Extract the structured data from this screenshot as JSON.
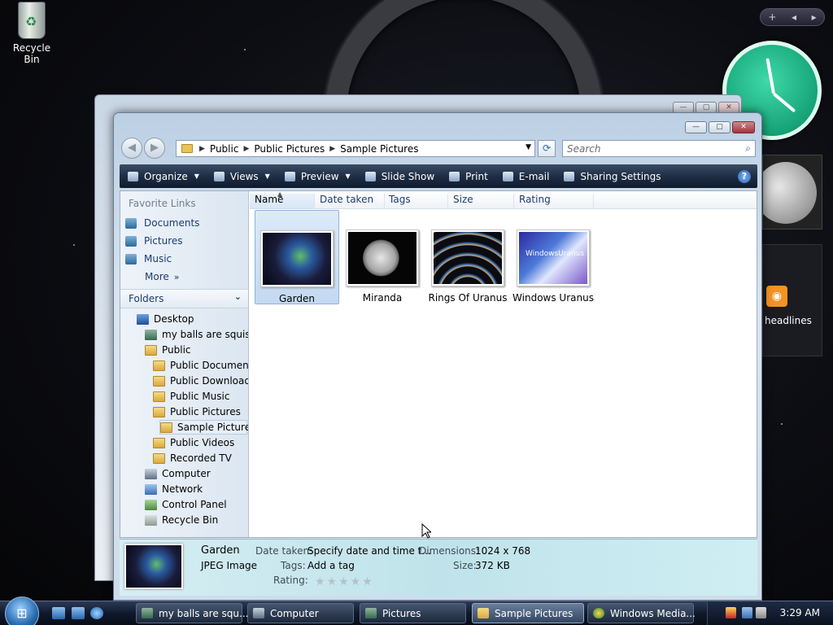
{
  "desktop": {
    "recycle_bin_label": "Recycle Bin"
  },
  "gadgets": {
    "feed_text": "headlines",
    "ctrl_add": "+",
    "ctrl_prev": "◂",
    "ctrl_next": "▸"
  },
  "window": {
    "controls": {
      "minimize": "—",
      "maximize": "▢",
      "close": "✕"
    },
    "address": {
      "crumbs": [
        "Public",
        "Public Pictures",
        "Sample Pictures"
      ]
    },
    "search_placeholder": "Search",
    "toolbar": {
      "organize": "Organize",
      "views": "Views",
      "preview": "Preview",
      "slideshow": "Slide Show",
      "print": "Print",
      "email": "E-mail",
      "sharing": "Sharing Settings"
    },
    "favorite_links": {
      "title": "Favorite Links",
      "items": [
        "Documents",
        "Pictures",
        "Music",
        "More"
      ]
    },
    "folders_title": "Folders",
    "tree": [
      "Desktop",
      "my balls are squishy",
      "Public",
      "Public Documents",
      "Public Downloads",
      "Public Music",
      "Public Pictures",
      "Sample Pictures",
      "Public Videos",
      "Recorded TV",
      "Computer",
      "Network",
      "Control Panel",
      "Recycle Bin"
    ],
    "columns": [
      "Name",
      "Date taken",
      "Tags",
      "Size",
      "Rating"
    ],
    "files": [
      {
        "name": "Garden",
        "selected": true
      },
      {
        "name": "Miranda",
        "selected": false
      },
      {
        "name": "Rings Of Uranus",
        "selected": false
      },
      {
        "name": "Windows Uranus",
        "selected": false
      }
    ],
    "thumb_text_wuranus": "WindowsUranus",
    "details": {
      "name": "Garden",
      "type": "JPEG Image",
      "date_label": "Date taken:",
      "date_value": "Specify date and time t...",
      "tags_label": "Tags:",
      "tags_value": "Add a tag",
      "rating_label": "Rating:",
      "rating_stars": "★★★★★",
      "rating_value": 0,
      "dimensions_label": "Dimensions:",
      "dimensions_value": "1024 x 768",
      "size_label": "Size:",
      "size_value": "372 KB"
    }
  },
  "taskbar": {
    "tasks": [
      "my balls are squ...",
      "Computer",
      "Pictures",
      "Sample Pictures",
      "Windows Media..."
    ],
    "time": "3:29 AM"
  },
  "colors": {
    "toolbar": "#1f2e45",
    "details_bg": "#bfe3ea",
    "selection": "#c3d9f1"
  }
}
